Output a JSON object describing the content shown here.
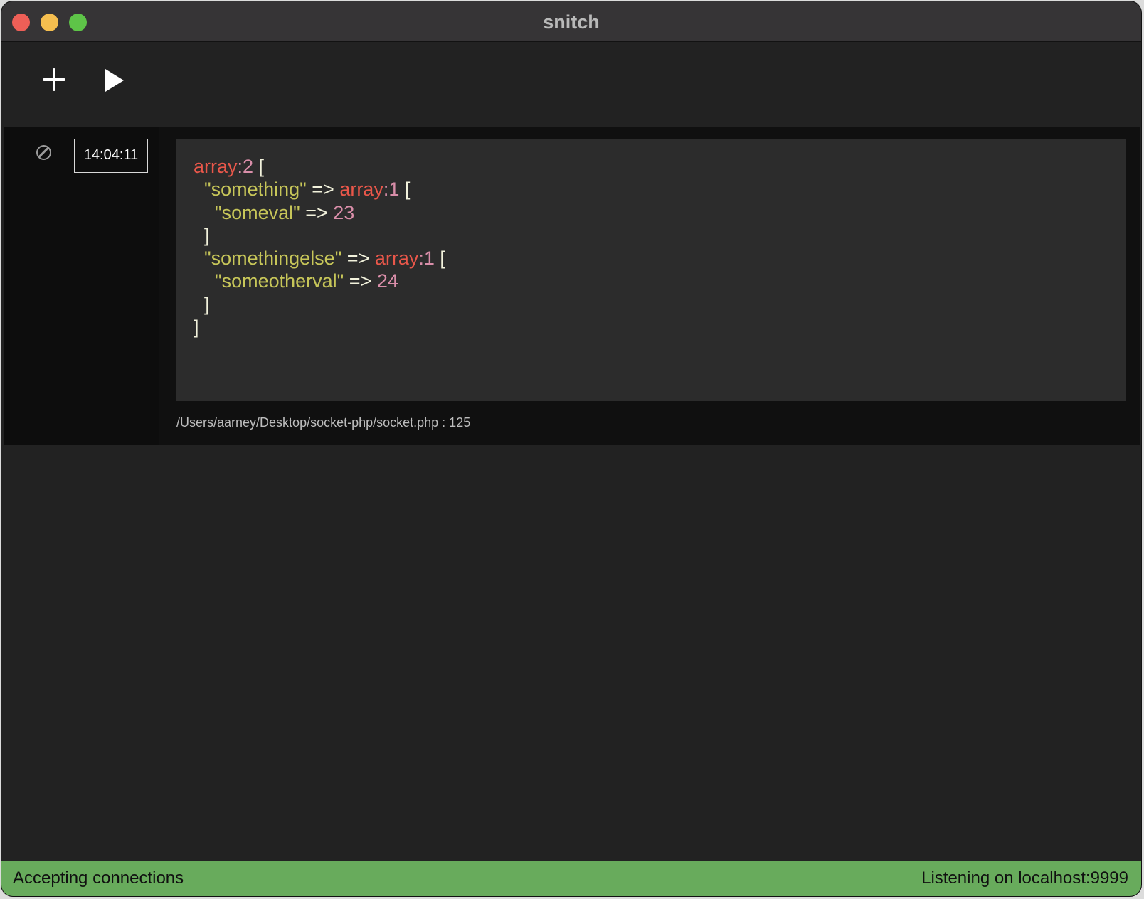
{
  "window": {
    "title": "snitch"
  },
  "toolbar": {
    "add_icon": "plus-icon",
    "play_icon": "play-icon"
  },
  "entries": [
    {
      "timestamp": "14:04:11",
      "block_icon": "block-icon",
      "dump_lines": [
        [
          {
            "t": "array",
            "c": "kw"
          },
          {
            "t": ":2",
            "c": "num"
          },
          {
            "t": " [",
            "c": "p"
          }
        ],
        [
          {
            "t": "  ",
            "c": "p"
          },
          {
            "t": "\"something\"",
            "c": "str"
          },
          {
            "t": " => ",
            "c": "p"
          },
          {
            "t": "array",
            "c": "kw"
          },
          {
            "t": ":1",
            "c": "num"
          },
          {
            "t": " [",
            "c": "p"
          }
        ],
        [
          {
            "t": "    ",
            "c": "p"
          },
          {
            "t": "\"someval\"",
            "c": "str"
          },
          {
            "t": " => ",
            "c": "p"
          },
          {
            "t": "23",
            "c": "num"
          }
        ],
        [
          {
            "t": "  ]",
            "c": "p"
          }
        ],
        [
          {
            "t": "  ",
            "c": "p"
          },
          {
            "t": "\"somethingelse\"",
            "c": "str"
          },
          {
            "t": " => ",
            "c": "p"
          },
          {
            "t": "array",
            "c": "kw"
          },
          {
            "t": ":1",
            "c": "num"
          },
          {
            "t": " [",
            "c": "p"
          }
        ],
        [
          {
            "t": "    ",
            "c": "p"
          },
          {
            "t": "\"someotherval\"",
            "c": "str"
          },
          {
            "t": " => ",
            "c": "p"
          },
          {
            "t": "24",
            "c": "num"
          }
        ],
        [
          {
            "t": "  ]",
            "c": "p"
          }
        ],
        [
          {
            "t": "]",
            "c": "p"
          }
        ]
      ],
      "source": "/Users/aarney/Desktop/socket-php/socket.php : 125"
    }
  ],
  "status": {
    "left": "Accepting connections",
    "right": "Listening on localhost:9999",
    "color": "#68ab5c"
  },
  "colors": {
    "keyword": "#e9574a",
    "number": "#d98ea9",
    "string": "#c7c659",
    "punct": "#f2f2dc"
  }
}
